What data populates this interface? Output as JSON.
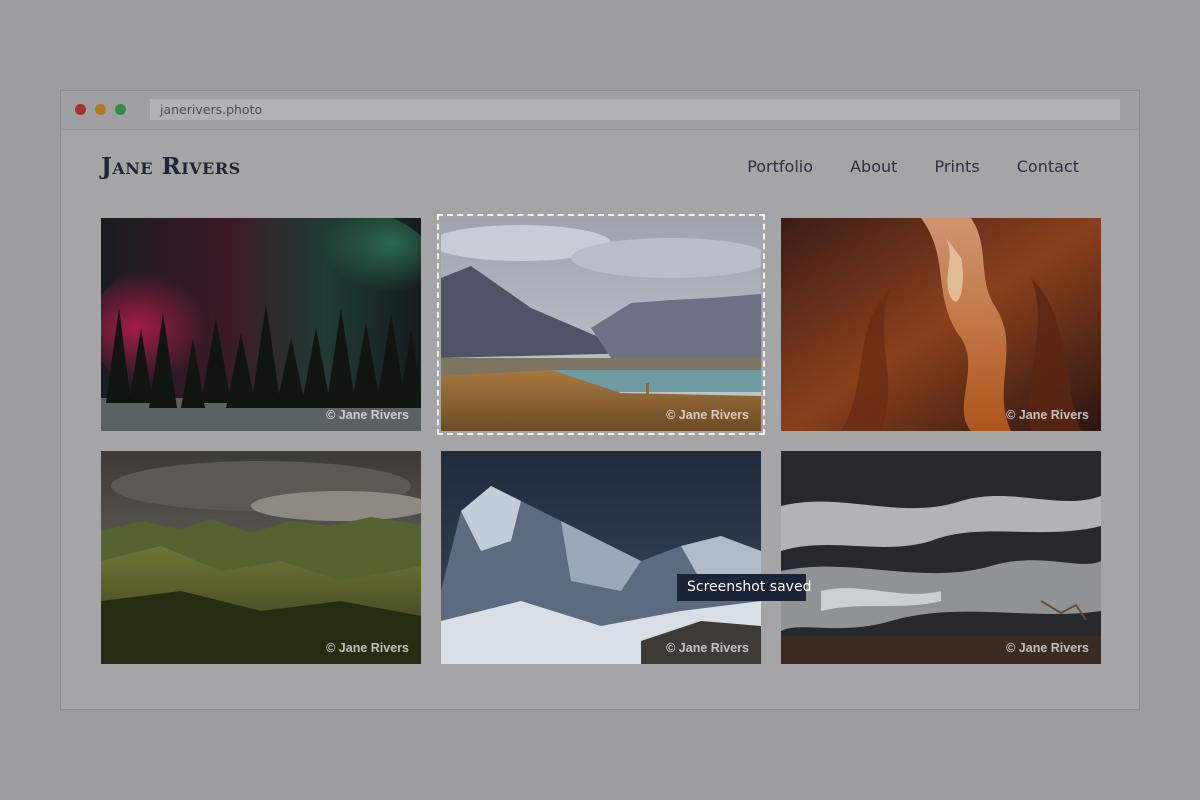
{
  "browser": {
    "address": "janerivers.photo"
  },
  "site": {
    "brand": "Jane Rivers",
    "nav": [
      "Portfolio",
      "About",
      "Prints",
      "Contact"
    ]
  },
  "gallery": {
    "photos": [
      {
        "subject": "aurora-forest",
        "credit": "© Jane Rivers"
      },
      {
        "subject": "mountain-lake-vicuna",
        "credit": "© Jane Rivers",
        "selected": true
      },
      {
        "subject": "slot-canyon",
        "credit": "© Jane Rivers"
      },
      {
        "subject": "green-hills-storm",
        "credit": "© Jane Rivers"
      },
      {
        "subject": "snowy-peaks",
        "credit": "© Jane Rivers"
      },
      {
        "subject": "ocean-waves-rocks",
        "credit": "© Jane Rivers"
      }
    ]
  },
  "toast": {
    "message": "Screenshot saved"
  }
}
